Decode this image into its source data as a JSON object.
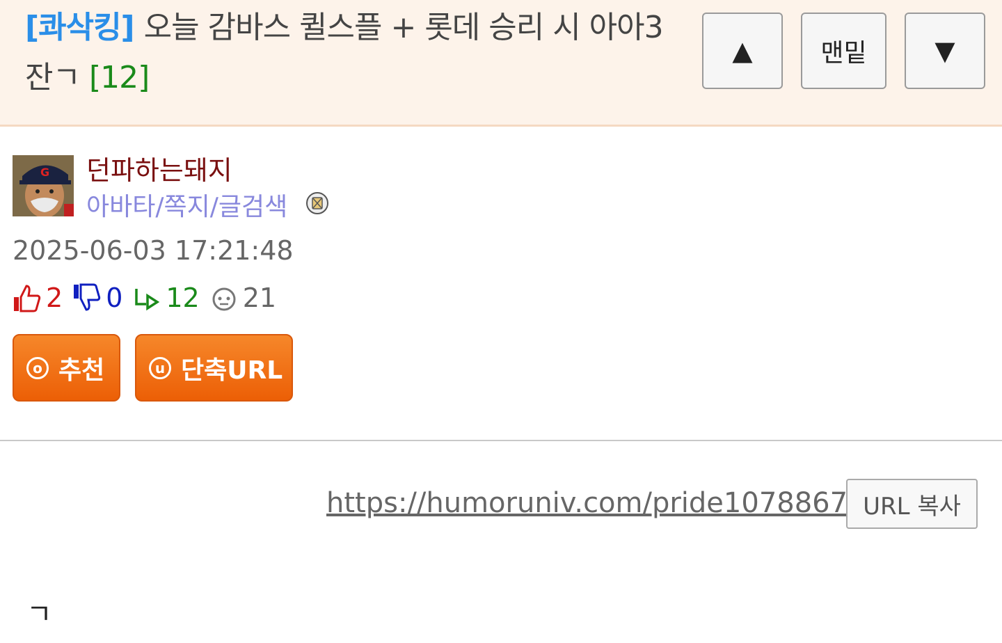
{
  "header": {
    "category": "[콰삭킹]",
    "title": "오늘 감바스 퀼스플 + 롯데 승리 시 아아3잔ㄱ",
    "comment_count": "[12]",
    "buttons": {
      "up": "▲",
      "bottom": "맨밑",
      "down": "▼"
    }
  },
  "author": {
    "nickname": "던파하는돼지",
    "links": "아바타/쪽지/글검색",
    "icons": {
      "avatar": "avatar-image",
      "ignore": "ignore-icon"
    }
  },
  "post": {
    "datetime": "2025-06-03 17:21:48",
    "stats": {
      "recommend": "2",
      "downvote": "0",
      "replies": "12",
      "views": "21"
    },
    "buttons": {
      "recommend": "추천",
      "recommend_icon": "o",
      "short_url": "단축URL",
      "short_url_icon": "u"
    },
    "url": "https://humoruniv.com/pride1078867",
    "copy_button": "URL 복사",
    "body": "ㄱ"
  },
  "colors": {
    "header_bg": "#fdf3ea",
    "category": "#2a8ee8",
    "comment_count": "#1a8a1a",
    "nickname": "#7a1010",
    "links": "#8888dd",
    "orange_button": "#ec5f06"
  }
}
